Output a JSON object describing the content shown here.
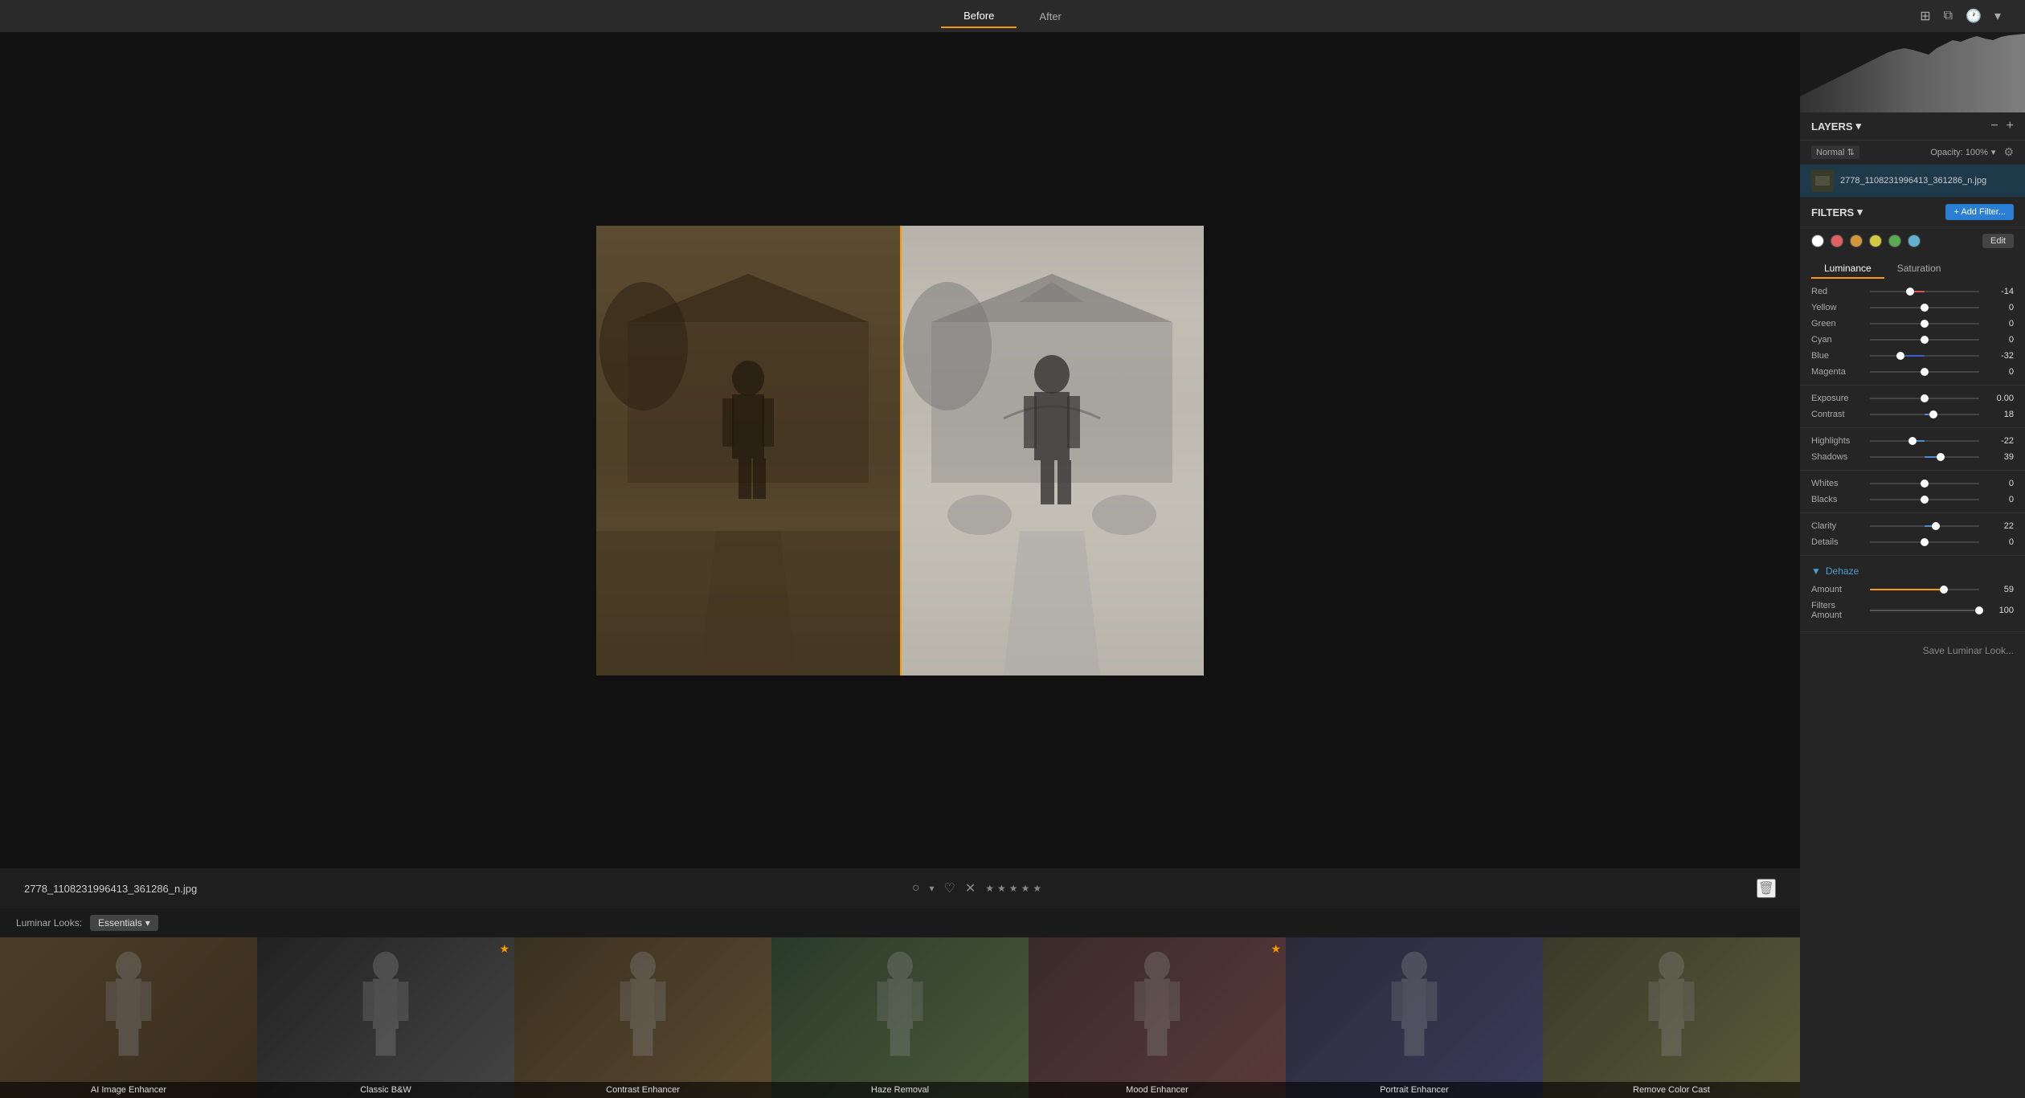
{
  "topBar": {
    "beforeLabel": "Before",
    "afterLabel": "After"
  },
  "imageFile": {
    "name": "2778_1108231996413_361286_n.jpg"
  },
  "rating": {
    "stars": [
      "★",
      "★",
      "★",
      "★",
      "★"
    ]
  },
  "looks": {
    "label": "Luminar Looks:",
    "essentials": "Essentials",
    "thumbnails": [
      {
        "name": "AI Image Enhancer",
        "starred": false,
        "colorClass": "thumb-0"
      },
      {
        "name": "Classic B&W",
        "starred": true,
        "colorClass": "thumb-1"
      },
      {
        "name": "Contrast Enhancer",
        "starred": false,
        "colorClass": "thumb-2"
      },
      {
        "name": "Haze Removal",
        "starred": false,
        "colorClass": "thumb-3"
      },
      {
        "name": "Mood Enhancer",
        "starred": true,
        "colorClass": "thumb-4"
      },
      {
        "name": "Portrait Enhancer",
        "starred": false,
        "colorClass": "thumb-5"
      },
      {
        "name": "Remove Color Cast",
        "starred": false,
        "colorClass": "thumb-6"
      }
    ]
  },
  "rightPanel": {
    "layers": {
      "title": "LAYERS",
      "blendMode": "Normal",
      "opacity": "Opacity: 100%",
      "filename": "2778_1108231996413_361286_n.jpg"
    },
    "filters": {
      "title": "FILTERS",
      "addButton": "+ Add Filter...",
      "editButton": "Edit",
      "colorDots": [
        "#fff",
        "#e06060",
        "#d4943a",
        "#d4c840",
        "#5aaa50",
        "#60b0d0"
      ]
    },
    "luminanceSaturation": {
      "tabs": [
        "Luminance",
        "Saturation"
      ],
      "activeTab": "Luminance",
      "sliders": [
        {
          "label": "Red",
          "value": -14,
          "percent": 37,
          "color": "#e05050"
        },
        {
          "label": "Yellow",
          "value": 0,
          "percent": 50,
          "color": "#d4c840"
        },
        {
          "label": "Green",
          "value": 0,
          "percent": 50,
          "color": "#5aaa50"
        },
        {
          "label": "Cyan",
          "value": 0,
          "percent": 50,
          "color": "#40a0b0"
        },
        {
          "label": "Blue",
          "value": -32,
          "percent": 28,
          "color": "#4060c0"
        },
        {
          "label": "Magenta",
          "value": 0,
          "percent": 50,
          "color": "#c050a0"
        }
      ]
    },
    "toneSliders": [
      {
        "label": "Exposure",
        "value": "0.00",
        "percent": 50
      },
      {
        "label": "Contrast",
        "value": "18",
        "percent": 58
      }
    ],
    "lightSliders": [
      {
        "label": "Highlights",
        "value": "-22",
        "percent": 39
      },
      {
        "label": "Shadows",
        "value": "39",
        "percent": 65
      }
    ],
    "wb": [
      {
        "label": "Whites",
        "value": "0",
        "percent": 50
      },
      {
        "label": "Blacks",
        "value": "0",
        "percent": 50
      }
    ],
    "detail": [
      {
        "label": "Clarity",
        "value": "22",
        "percent": 60
      },
      {
        "label": "Details",
        "value": "0",
        "percent": 50
      }
    ],
    "dehaze": {
      "title": "Dehaze",
      "amountLabel": "Amount",
      "amountValue": "59",
      "amountPercent": 68,
      "filtersAmountLabel": "Filters Amount",
      "filtersAmountValue": "100",
      "filtersAmountPercent": 100
    },
    "saveButton": "Save Luminar Look..."
  }
}
